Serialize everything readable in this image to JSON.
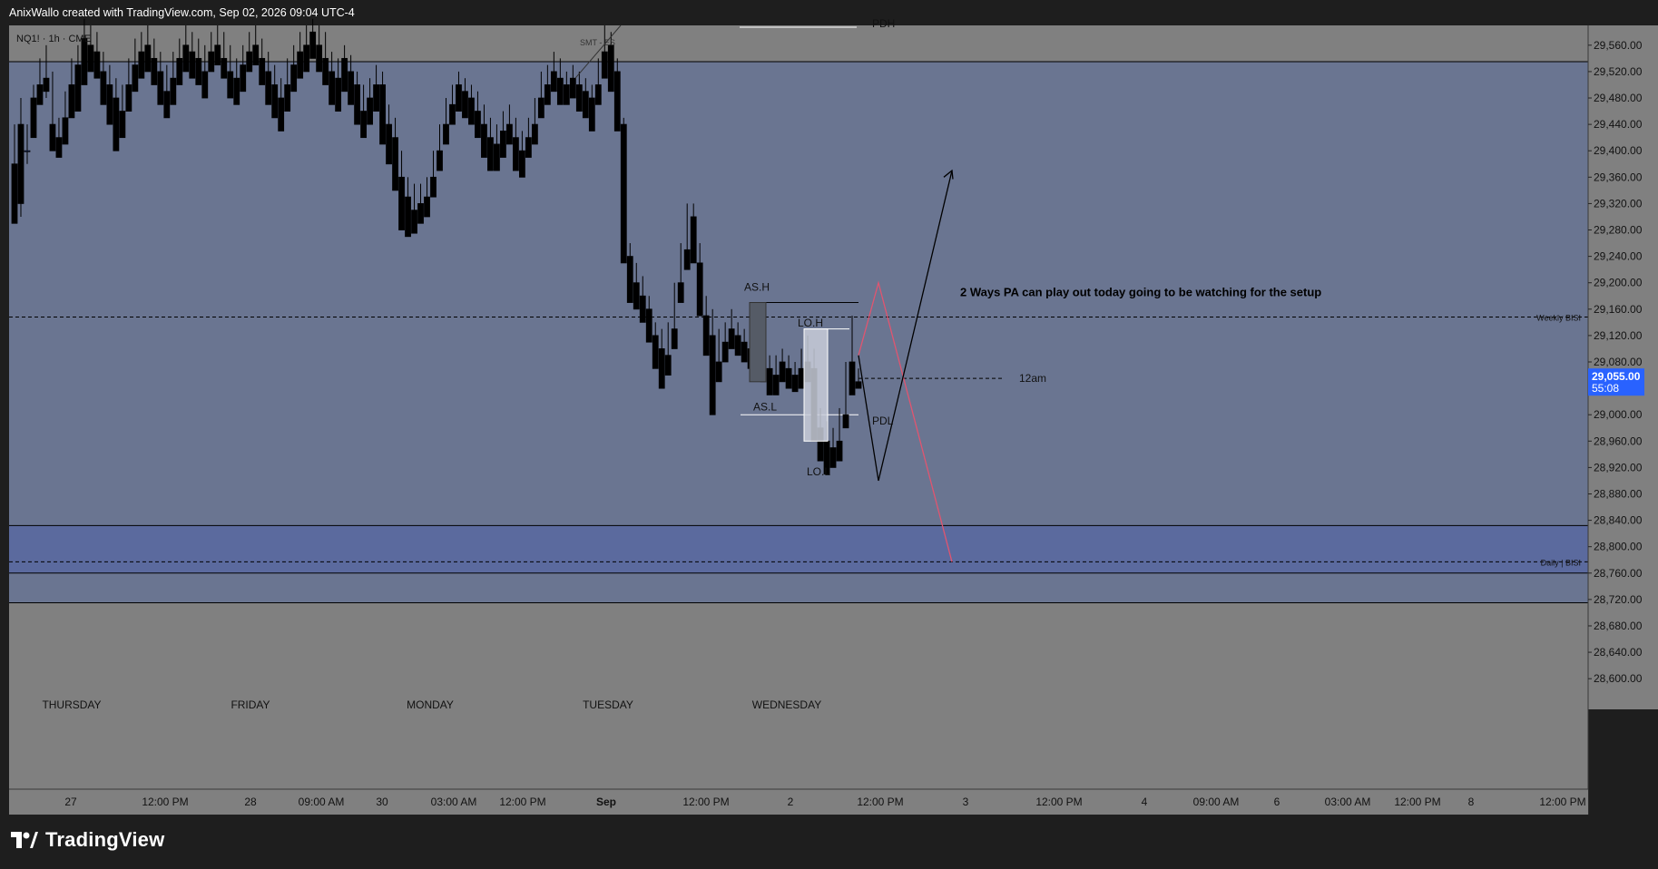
{
  "header": {
    "credit": "AnixWallo created with TradingView.com, Sep 02, 2026 09:04 UTC-4"
  },
  "footer": {
    "brand": "TradingView"
  },
  "chart_data": {
    "type": "candlestick",
    "title": "",
    "symbol_label": "NQ1! · 1h · CME",
    "ylim": [
      28570,
      29590
    ],
    "y_ticks": [
      "29,560.00",
      "29,520.00",
      "29,480.00",
      "29,440.00",
      "29,400.00",
      "29,360.00",
      "29,320.00",
      "29,280.00",
      "29,240.00",
      "29,200.00",
      "29,160.00",
      "29,120.00",
      "29,080.00",
      "29,040.00",
      "29,000.00",
      "28,960.00",
      "28,920.00",
      "28,880.00",
      "28,840.00",
      "28,800.00",
      "28,760.00",
      "28,720.00",
      "28,680.00",
      "28,640.00",
      "28,600.00"
    ],
    "x_ticks": [
      "27",
      "12:00 PM",
      "28",
      "09:00 AM",
      "30",
      "03:00 AM",
      "12:00 PM",
      "Sep",
      "12:00 PM",
      "2",
      "12:00 PM",
      "3",
      "12:00 PM",
      "4",
      "09:00 AM",
      "6",
      "03:00 AM",
      "12:00 PM",
      "8",
      "12:00 PM"
    ],
    "weekday_labels": [
      "THURSDAY",
      "FRIDAY",
      "MONDAY",
      "TUESDAY",
      "WEDNESDAY"
    ],
    "current_price": {
      "label": "29,055.00",
      "countdown": "55:08",
      "color": "#2962ff"
    },
    "colors": {
      "up": "#2962ff",
      "down": "#000000",
      "background": "#6a7591",
      "outside": "#808080",
      "zone": "#5b6a9e",
      "projection_red": "#e05570",
      "projection_black": "#000000"
    },
    "zones": [
      {
        "name": "premium-range",
        "from": 29535,
        "to": 29590
      },
      {
        "name": "discount-zone",
        "from": 28760,
        "to": 28832
      }
    ],
    "levels": [
      {
        "label": "Weekly BISI",
        "price": 29148,
        "style": "dashed"
      },
      {
        "label": "Daily | BISI",
        "price": 28777,
        "style": "dashed"
      },
      {
        "label": "12am",
        "price": 29055,
        "style": "dashed"
      },
      {
        "label": "PDH",
        "price": 29590,
        "style": "solid"
      },
      {
        "label": "PDL",
        "price": 29000,
        "style": "solid"
      }
    ],
    "session_labels": [
      {
        "label": "AS.H",
        "price": 29188
      },
      {
        "label": "AS.L",
        "price": 29012
      },
      {
        "label": "LO.H",
        "price": 29142
      },
      {
        "label": "LO.L",
        "price": 28919
      }
    ],
    "marker_text": "SMT - ES",
    "annotation": "2 Ways PA can play out today going to be watching for the setup",
    "candles": [
      [
        29380,
        29440,
        29300,
        29290
      ],
      [
        29440,
        29480,
        29300,
        29320
      ],
      [
        29400,
        29440,
        29380,
        29400
      ],
      [
        29480,
        29500,
        29460,
        29420
      ],
      [
        29500,
        29540,
        29480,
        29470
      ],
      [
        29510,
        29560,
        29480,
        29490
      ],
      [
        29440,
        29520,
        29420,
        29400
      ],
      [
        29420,
        29450,
        29410,
        29390
      ],
      [
        29450,
        29490,
        29440,
        29410
      ],
      [
        29500,
        29540,
        29470,
        29450
      ],
      [
        29530,
        29560,
        29500,
        29460
      ],
      [
        29570,
        29600,
        29520,
        29500
      ],
      [
        29560,
        29590,
        29540,
        29520
      ],
      [
        29550,
        29580,
        29530,
        29510
      ],
      [
        29520,
        29550,
        29480,
        29470
      ],
      [
        29500,
        29530,
        29460,
        29440
      ],
      [
        29480,
        29510,
        29420,
        29400
      ],
      [
        29460,
        29500,
        29440,
        29420
      ],
      [
        29500,
        29540,
        29480,
        29460
      ],
      [
        29530,
        29570,
        29500,
        29490
      ],
      [
        29550,
        29580,
        29520,
        29510
      ],
      [
        29560,
        29590,
        29540,
        29520
      ],
      [
        29540,
        29570,
        29510,
        29500
      ],
      [
        29520,
        29550,
        29490,
        29470
      ],
      [
        29490,
        29530,
        29470,
        29450
      ],
      [
        29510,
        29550,
        29490,
        29470
      ],
      [
        29540,
        29570,
        29520,
        29500
      ],
      [
        29560,
        29590,
        29540,
        29520
      ],
      [
        29550,
        29580,
        29530,
        29510
      ],
      [
        29540,
        29570,
        29510,
        29500
      ],
      [
        29520,
        29560,
        29500,
        29480
      ],
      [
        29550,
        29580,
        29530,
        29520
      ],
      [
        29560,
        29590,
        29540,
        29530
      ],
      [
        29540,
        29580,
        29520,
        29510
      ],
      [
        29520,
        29560,
        29500,
        29480
      ],
      [
        29510,
        29540,
        29490,
        29470
      ],
      [
        29530,
        29560,
        29510,
        29490
      ],
      [
        29550,
        29580,
        29530,
        29520
      ],
      [
        29560,
        29590,
        29540,
        29530
      ],
      [
        29540,
        29570,
        29520,
        29500
      ],
      [
        29520,
        29550,
        29490,
        29470
      ],
      [
        29500,
        29530,
        29470,
        29450
      ],
      [
        29480,
        29510,
        29450,
        29430
      ],
      [
        29500,
        29540,
        29480,
        29460
      ],
      [
        29530,
        29560,
        29510,
        29490
      ],
      [
        29550,
        29580,
        29530,
        29510
      ],
      [
        29560,
        29590,
        29540,
        29520
      ],
      [
        29580,
        29600,
        29550,
        29540
      ],
      [
        29560,
        29590,
        29530,
        29520
      ],
      [
        29540,
        29580,
        29510,
        29500
      ],
      [
        29520,
        29550,
        29490,
        29470
      ],
      [
        29510,
        29540,
        29480,
        29460
      ],
      [
        29540,
        29560,
        29500,
        29490
      ],
      [
        29520,
        29545,
        29490,
        29470
      ],
      [
        29500,
        29520,
        29450,
        29440
      ],
      [
        29460,
        29500,
        29430,
        29420
      ],
      [
        29480,
        29510,
        29460,
        29440
      ],
      [
        29500,
        29530,
        29470,
        29460
      ],
      [
        29500,
        29520,
        29440,
        29410
      ],
      [
        29440,
        29470,
        29400,
        29380
      ],
      [
        29420,
        29450,
        29360,
        29340
      ],
      [
        29360,
        29400,
        29300,
        29280
      ],
      [
        29330,
        29360,
        29290,
        29270
      ],
      [
        29310,
        29350,
        29290,
        29275
      ],
      [
        29320,
        29350,
        29300,
        29290
      ],
      [
        29330,
        29360,
        29310,
        29300
      ],
      [
        29360,
        29400,
        29340,
        29330
      ],
      [
        29400,
        29440,
        29380,
        29370
      ],
      [
        29440,
        29480,
        29420,
        29410
      ],
      [
        29470,
        29500,
        29450,
        29440
      ],
      [
        29500,
        29520,
        29470,
        29460
      ],
      [
        29490,
        29510,
        29460,
        29450
      ],
      [
        29480,
        29500,
        29450,
        29440
      ],
      [
        29460,
        29490,
        29430,
        29420
      ],
      [
        29440,
        29470,
        29400,
        29390
      ],
      [
        29420,
        29450,
        29380,
        29370
      ],
      [
        29410,
        29440,
        29380,
        29370
      ],
      [
        29430,
        29460,
        29400,
        29390
      ],
      [
        29440,
        29470,
        29420,
        29410
      ],
      [
        29420,
        29450,
        29380,
        29370
      ],
      [
        29400,
        29430,
        29370,
        29360
      ],
      [
        29420,
        29450,
        29400,
        29390
      ],
      [
        29440,
        29480,
        29420,
        29410
      ],
      [
        29480,
        29520,
        29460,
        29450
      ],
      [
        29500,
        29530,
        29480,
        29470
      ],
      [
        29520,
        29550,
        29500,
        29490
      ],
      [
        29510,
        29540,
        29480,
        29470
      ],
      [
        29500,
        29520,
        29480,
        29470
      ],
      [
        29510,
        29530,
        29490,
        29480
      ],
      [
        29500,
        29520,
        29470,
        29460
      ],
      [
        29490,
        29510,
        29460,
        29450
      ],
      [
        29480,
        29500,
        29440,
        29430
      ],
      [
        29500,
        29540,
        29480,
        29470
      ],
      [
        29550,
        29590,
        29520,
        29510
      ],
      [
        29560,
        29580,
        29500,
        29490
      ],
      [
        29520,
        29540,
        29440,
        29430
      ],
      [
        29440,
        29450,
        29240,
        29230
      ],
      [
        29240,
        29260,
        29180,
        29170
      ],
      [
        29200,
        29230,
        29170,
        29160
      ],
      [
        29180,
        29210,
        29150,
        29140
      ],
      [
        29160,
        29180,
        29120,
        29110
      ],
      [
        29120,
        29140,
        29080,
        29070
      ],
      [
        29100,
        29130,
        29060,
        29040
      ],
      [
        29090,
        29140,
        29070,
        29060
      ],
      [
        29130,
        29200,
        29110,
        29100
      ],
      [
        29200,
        29260,
        29180,
        29170
      ],
      [
        29250,
        29320,
        29230,
        29220
      ],
      [
        29300,
        29320,
        29250,
        29230
      ],
      [
        29230,
        29260,
        29160,
        29150
      ],
      [
        29150,
        29180,
        29100,
        29090
      ],
      [
        29120,
        29160,
        29080,
        29000
      ],
      [
        29080,
        29130,
        29060,
        29050
      ],
      [
        29110,
        29140,
        29090,
        29080
      ],
      [
        29130,
        29160,
        29110,
        29100
      ],
      [
        29120,
        29140,
        29100,
        29090
      ],
      [
        29110,
        29130,
        29090,
        29080
      ],
      [
        29100,
        29140,
        29080,
        29070
      ],
      [
        29120,
        29140,
        29090,
        29070
      ],
      [
        29090,
        29120,
        29060,
        29050
      ],
      [
        29070,
        29090,
        29040,
        29030
      ],
      [
        29060,
        29090,
        29040,
        29030
      ],
      [
        29080,
        29100,
        29060,
        29050
      ],
      [
        29070,
        29090,
        29050,
        29040
      ],
      [
        29060,
        29080,
        29040,
        29035
      ],
      [
        29070,
        29100,
        29050,
        29040
      ],
      [
        29080,
        29120,
        29060,
        29050
      ],
      [
        29070,
        29100,
        28970,
        28960
      ],
      [
        28980,
        29010,
        28940,
        28930
      ],
      [
        28960,
        28990,
        28920,
        28910
      ],
      [
        28950,
        28980,
        28930,
        28920
      ],
      [
        28960,
        29010,
        28940,
        28930
      ],
      [
        29000,
        29080,
        28990,
        28980
      ],
      [
        29080,
        29150,
        29040,
        29030
      ],
      [
        29050,
        29070,
        29040,
        29040
      ]
    ]
  }
}
